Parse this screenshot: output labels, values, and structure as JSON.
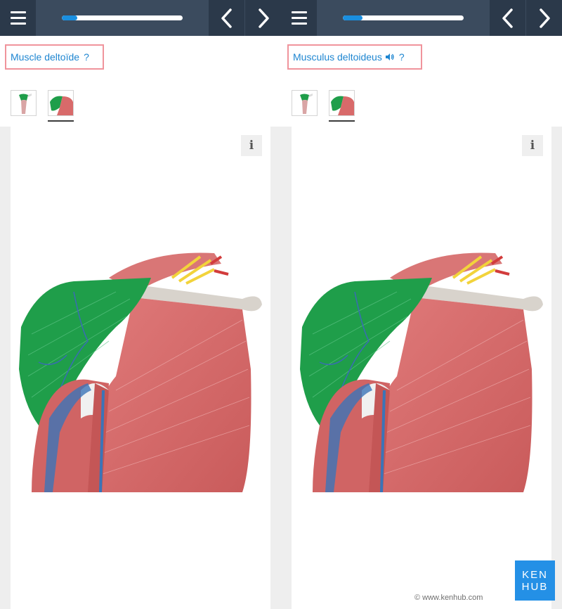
{
  "panels": [
    {
      "title": "Muscle deltoïde",
      "help_mark": "?",
      "has_audio": false,
      "progress": 0.13,
      "info_label": "i"
    },
    {
      "title": "Musculus deltoideus",
      "help_mark": "?",
      "has_audio": true,
      "progress": 0.16,
      "info_label": "i"
    }
  ],
  "icons": {
    "menu": "hamburger-menu-icon",
    "prev": "chevron-left-icon",
    "next": "chevron-right-icon",
    "audio": "speaker-icon",
    "info": "info-icon"
  },
  "branding": {
    "logo_line1": "KEN",
    "logo_line2": "HUB",
    "copyright": "© www.kenhub.com"
  },
  "colors": {
    "topbar": "#3b4b5e",
    "topbar_dark": "#2b394a",
    "progress_fill": "#1a8fe0",
    "title_text": "#1e86d1",
    "highlight_border": "#f0949c",
    "deltoid_highlight": "#1f9e4a",
    "muscle": "#d86a6a",
    "brand": "#2490e6"
  }
}
